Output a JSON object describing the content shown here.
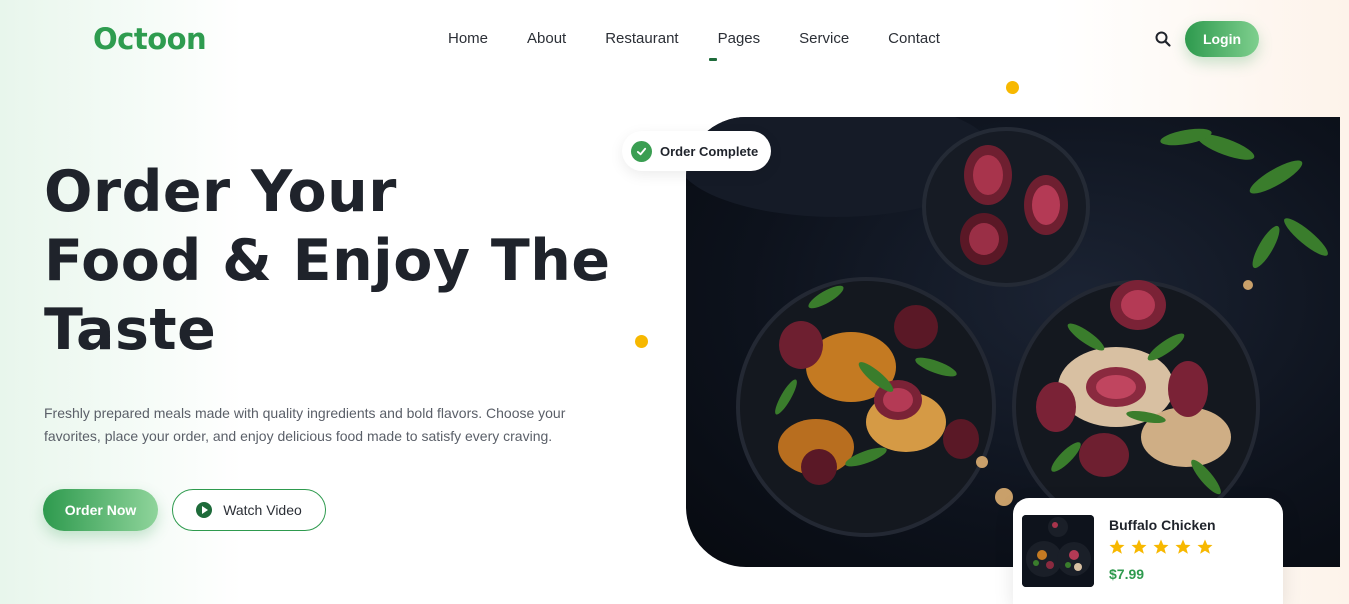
{
  "brand": {
    "logo": "Octoon",
    "accent_color": "#2e9a4e"
  },
  "nav": {
    "items": [
      {
        "label": "Home"
      },
      {
        "label": "About"
      },
      {
        "label": "Restaurant"
      },
      {
        "label": "Pages"
      },
      {
        "label": "Service"
      },
      {
        "label": "Contact"
      }
    ],
    "search_icon": "search-icon",
    "login_label": "Login"
  },
  "hero": {
    "title_lines": [
      "Order Your",
      "Food & Enjoy The",
      "Taste"
    ],
    "description_lines": [
      "Freshly prepared meals made with quality ingredients and bold flavors. Choose your",
      "favorites, place your order, and enjoy delicious food made to satisfy every craving."
    ],
    "order_button": "Order Now",
    "watch_button": "Watch Video"
  },
  "badge": {
    "text": "Order Complete",
    "icon": "check-icon"
  },
  "product_card": {
    "name": "Buffalo Chicken",
    "rating": 5,
    "rating_max": 5,
    "price": "$7.99",
    "star_color": "#f7b800"
  }
}
